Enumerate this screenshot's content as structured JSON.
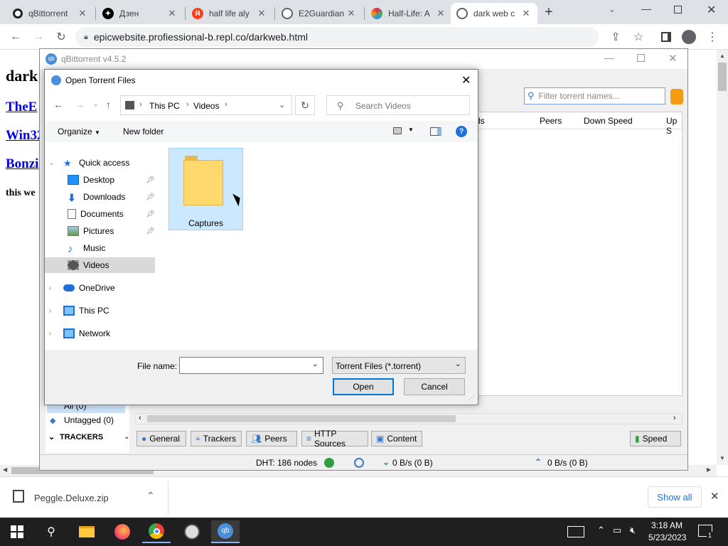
{
  "browser": {
    "tabs": [
      {
        "title": "qBittorrent",
        "icon": "qbittorrent-tab-icon"
      },
      {
        "title": "Дзен",
        "icon": "zen-tab-icon"
      },
      {
        "title": "half life aly",
        "icon": "yandex-tab-icon"
      },
      {
        "title": "E2Guardian",
        "icon": "globe-tab-icon"
      },
      {
        "title": "Half-Life: A",
        "icon": "colorful-star-tab-icon"
      },
      {
        "title": "dark web c",
        "icon": "globe-tab-icon"
      }
    ],
    "address": "epicwebsite.profiessional-b.repl.co/darkweb.html"
  },
  "webpage": {
    "heading": "dark",
    "links": [
      "TheE",
      "Win32",
      "Bonzi"
    ],
    "text": "this we"
  },
  "qbittorrent": {
    "title": "qBittorrent v4.5.2",
    "search_placeholder": "Filter torrent names...",
    "columns": [
      "ds",
      "Peers",
      "Down Speed",
      "Up S"
    ],
    "filters": {
      "all": "All (0)",
      "untagged": "Untagged (0)",
      "trackers": "TRACKERS"
    },
    "tabs": [
      "General",
      "Trackers",
      "Peers",
      "HTTP Sources",
      "Content"
    ],
    "speed_button": "Speed",
    "status": {
      "dht": "DHT: 186 nodes",
      "down": "0 B/s (0 B)",
      "up": "0 B/s (0 B)"
    }
  },
  "dialog": {
    "title": "Open Torrent Files",
    "breadcrumb": [
      "This PC",
      "Videos"
    ],
    "search_placeholder": "Search Videos",
    "organize": "Organize",
    "new_folder": "New folder",
    "nav": [
      {
        "label": "Quick access",
        "kind": "header",
        "icon": "star-icon"
      },
      {
        "label": "Desktop",
        "kind": "pinned",
        "icon": "desktop-icon"
      },
      {
        "label": "Downloads",
        "kind": "pinned",
        "icon": "download-icon"
      },
      {
        "label": "Documents",
        "kind": "pinned",
        "icon": "document-icon"
      },
      {
        "label": "Pictures",
        "kind": "pinned",
        "icon": "pictures-icon"
      },
      {
        "label": "Music",
        "kind": "child",
        "icon": "music-icon"
      },
      {
        "label": "Videos",
        "kind": "selected",
        "icon": "videos-icon"
      },
      {
        "label": "OneDrive",
        "kind": "header",
        "icon": "cloud-icon"
      },
      {
        "label": "This PC",
        "kind": "header",
        "icon": "computer-icon"
      },
      {
        "label": "Network",
        "kind": "header",
        "icon": "network-icon"
      }
    ],
    "folder": "Captures",
    "file_name_label": "File name:",
    "file_name_value": "",
    "file_type": "Torrent Files (*.torrent)",
    "open": "Open",
    "cancel": "Cancel"
  },
  "downloads": {
    "file": "Peggle.Deluxe.zip",
    "show_all": "Show all"
  },
  "taskbar": {
    "time": "3:18 AM",
    "date": "5/23/2023",
    "notification_count": "1"
  }
}
